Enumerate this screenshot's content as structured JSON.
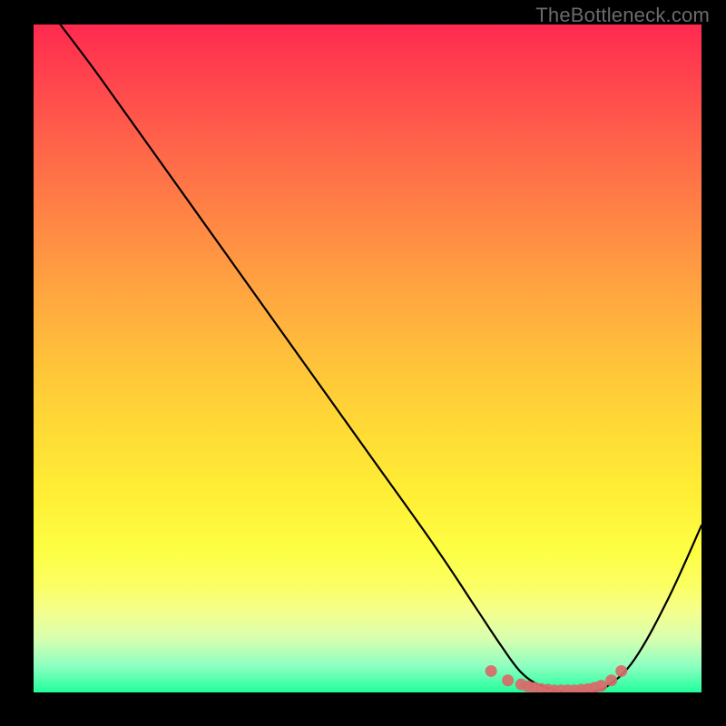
{
  "watermark": "TheBottleneck.com",
  "chart_data": {
    "type": "line",
    "title": "",
    "xlabel": "",
    "ylabel": "",
    "xlim": [
      0,
      100
    ],
    "ylim": [
      0,
      100
    ],
    "series": [
      {
        "name": "bottleneck-curve",
        "x": [
          4,
          10,
          20,
          30,
          40,
          50,
          60,
          66,
          70,
          73,
          76,
          80,
          83,
          86,
          90,
          95,
          100
        ],
        "y": [
          100,
          92,
          78,
          64,
          50,
          36,
          22,
          13,
          7,
          3,
          1,
          0,
          0,
          1,
          5,
          14,
          25
        ]
      }
    ],
    "markers": {
      "name": "low-bottleneck-points",
      "color": "#d96a6a",
      "x": [
        68.5,
        71,
        73,
        74,
        75,
        76,
        77,
        78,
        79,
        80,
        81,
        82,
        83,
        84,
        85,
        86.5,
        88
      ],
      "y": [
        3.2,
        1.8,
        1.2,
        0.9,
        0.7,
        0.5,
        0.4,
        0.3,
        0.3,
        0.3,
        0.3,
        0.4,
        0.5,
        0.7,
        1.0,
        1.8,
        3.2
      ]
    },
    "gradient_stops": [
      {
        "pct": 0,
        "color": "#ff2a4f"
      },
      {
        "pct": 50,
        "color": "#ffc13a"
      },
      {
        "pct": 80,
        "color": "#fdff44"
      },
      {
        "pct": 100,
        "color": "#20ff9c"
      }
    ]
  }
}
